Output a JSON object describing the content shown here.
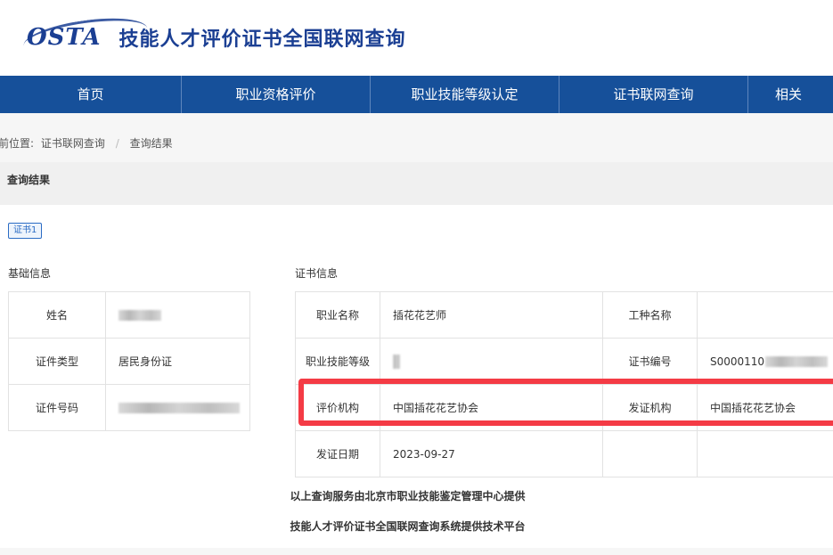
{
  "header": {
    "logo_text": "OSTA",
    "title": "技能人才评价证书全国联网查询"
  },
  "nav": {
    "items": [
      "首页",
      "职业资格评价",
      "职业技能等级认定",
      "证书联网查询",
      "相关"
    ]
  },
  "breadcrumb": {
    "label": "前位置:",
    "items": [
      "证书联网查询",
      "查询结果"
    ],
    "separator": "/"
  },
  "result": {
    "title": "查询结果",
    "cert_tag": "证书1"
  },
  "basic_info": {
    "heading": "基础信息",
    "rows": [
      {
        "key": "姓名",
        "value": ""
      },
      {
        "key": "证件类型",
        "value": "居民身份证"
      },
      {
        "key": "证件号码",
        "value": ""
      }
    ]
  },
  "cert_info": {
    "heading": "证书信息",
    "rows": [
      {
        "k1": "职业名称",
        "v1": "插花花艺师",
        "k2": "工种名称",
        "v2": ""
      },
      {
        "k1": "职业技能等级",
        "v1": "",
        "k2": "证书编号",
        "v2": "S0000110"
      },
      {
        "k1": "评价机构",
        "v1": "中国插花花艺协会",
        "k2": "发证机构",
        "v2": "中国插花花艺协会"
      },
      {
        "k1": "发证日期",
        "v1": "2023-09-27",
        "k2": "",
        "v2": ""
      }
    ]
  },
  "footer": {
    "line1": "以上查询服务由北京市职业技能鉴定管理中心提供",
    "line2": "技能人才评价证书全国联网查询系统提供技术平台"
  },
  "colors": {
    "nav_bg": "#16509a",
    "brand": "#1b3f93",
    "highlight": "#f43b45",
    "tag": "#2b6cc4"
  }
}
